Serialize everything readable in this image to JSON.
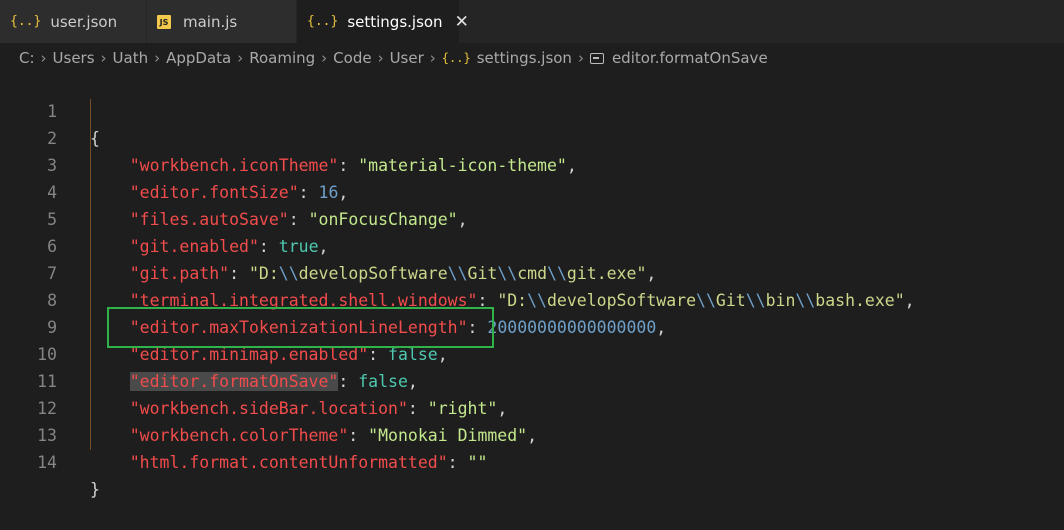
{
  "tabs": [
    {
      "label": "user.json",
      "icon": "json-braces-icon"
    },
    {
      "label": "main.js",
      "icon": "js-file-icon",
      "badge": "JS"
    },
    {
      "label": "settings.json",
      "icon": "json-braces-icon",
      "active": true,
      "close": "✕"
    }
  ],
  "icon_glyph": "{..}",
  "breadcrumb": [
    "C:",
    "Users",
    "Uath",
    "AppData",
    "Roaming",
    "Code",
    "User",
    "settings.json",
    "editor.formatOnSave"
  ],
  "lines": {
    "l1": {
      "num": "1"
    },
    "l2": {
      "num": "2",
      "key": "\"workbench.iconTheme\"",
      "value": "\"material-icon-theme\""
    },
    "l3": {
      "num": "3",
      "key": "\"editor.fontSize\"",
      "value": "16"
    },
    "l4": {
      "num": "4",
      "key": "\"files.autoSave\"",
      "value": "\"onFocusChange\""
    },
    "l5": {
      "num": "5",
      "key": "\"git.enabled\"",
      "value": "true"
    },
    "l6": {
      "num": "6",
      "key": "\"git.path\"",
      "v1": "\"D:",
      "v2": "developSoftware",
      "v3": "Git",
      "v4": "cmd",
      "v5": "git.exe\""
    },
    "l7": {
      "num": "7",
      "key": "\"terminal.integrated.shell.windows\"",
      "v1": "\"D:",
      "v2": "developSoftware",
      "v3": "Git",
      "v4": "bin",
      "v5": "bash.exe\""
    },
    "l8": {
      "num": "8",
      "key": "\"editor.maxTokenizationLineLength\"",
      "value": "20000000000000000"
    },
    "l9": {
      "num": "9",
      "key": "\"editor.minimap.enabled\"",
      "value": "false"
    },
    "l10": {
      "num": "10",
      "key": "\"editor.formatOnSave\"",
      "value": "false"
    },
    "l11": {
      "num": "11",
      "key": "\"workbench.sideBar.location\"",
      "value": "\"right\""
    },
    "l12": {
      "num": "12",
      "key": "\"workbench.colorTheme\"",
      "value": "\"Monokai Dimmed\""
    },
    "l13": {
      "num": "13",
      "key": "\"html.format.contentUnformatted\"",
      "value": "\"\""
    },
    "l14": {
      "num": "14"
    }
  },
  "punct": {
    "open": "{",
    "close": "}",
    "colon": ": ",
    "comma": ",",
    "esc": "\\\\"
  },
  "colors": {
    "key": "#f24c4c",
    "string": "#c3e88d",
    "number": "#6fa0c9",
    "boolean": "#4ec9b0",
    "annotation": "#2fb34a"
  }
}
